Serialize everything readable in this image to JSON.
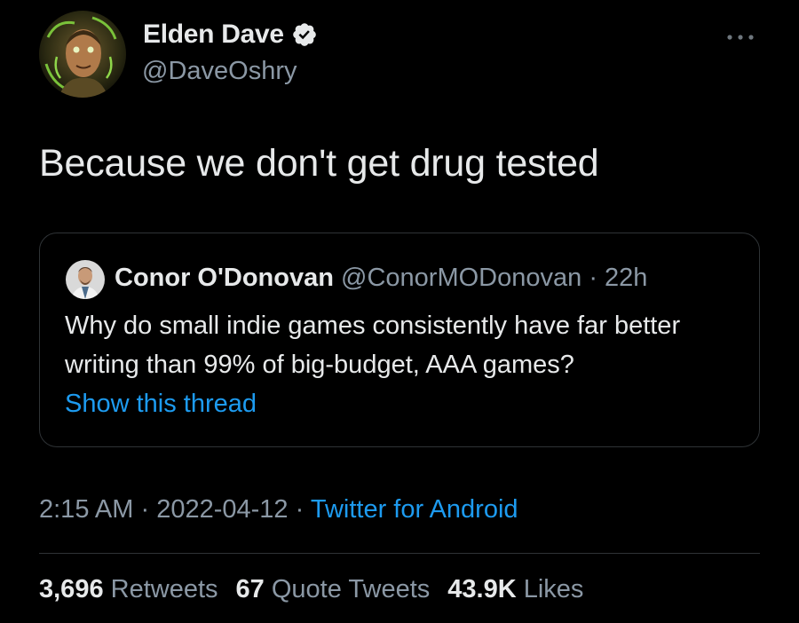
{
  "author": {
    "display_name": "Elden Dave",
    "handle": "@DaveOshry",
    "verified": true
  },
  "tweet": {
    "text": "Because we don't get drug tested"
  },
  "quoted_tweet": {
    "display_name": "Conor O'Donovan",
    "handle": "@ConorMODonovan",
    "separator": "·",
    "time": "22h",
    "text": "Why do small indie games consistently have far better writing than 99% of big-budget, AAA games?",
    "show_thread_label": "Show this thread"
  },
  "meta": {
    "time": "2:15 AM",
    "separator": "·",
    "date": "2022-04-12",
    "source": "Twitter for Android"
  },
  "stats": {
    "retweets_count": "3,696",
    "retweets_label": "Retweets",
    "quotes_count": "67",
    "quotes_label": "Quote Tweets",
    "likes_count": "43.9K",
    "likes_label": "Likes"
  },
  "colors": {
    "background": "#000000",
    "text_primary": "#e7e9ea",
    "text_secondary": "#8b98a5",
    "link": "#1d9bf0",
    "border": "#2f3336"
  },
  "icons": {
    "verified": "verified-badge-icon",
    "more": "more-options-icon"
  }
}
